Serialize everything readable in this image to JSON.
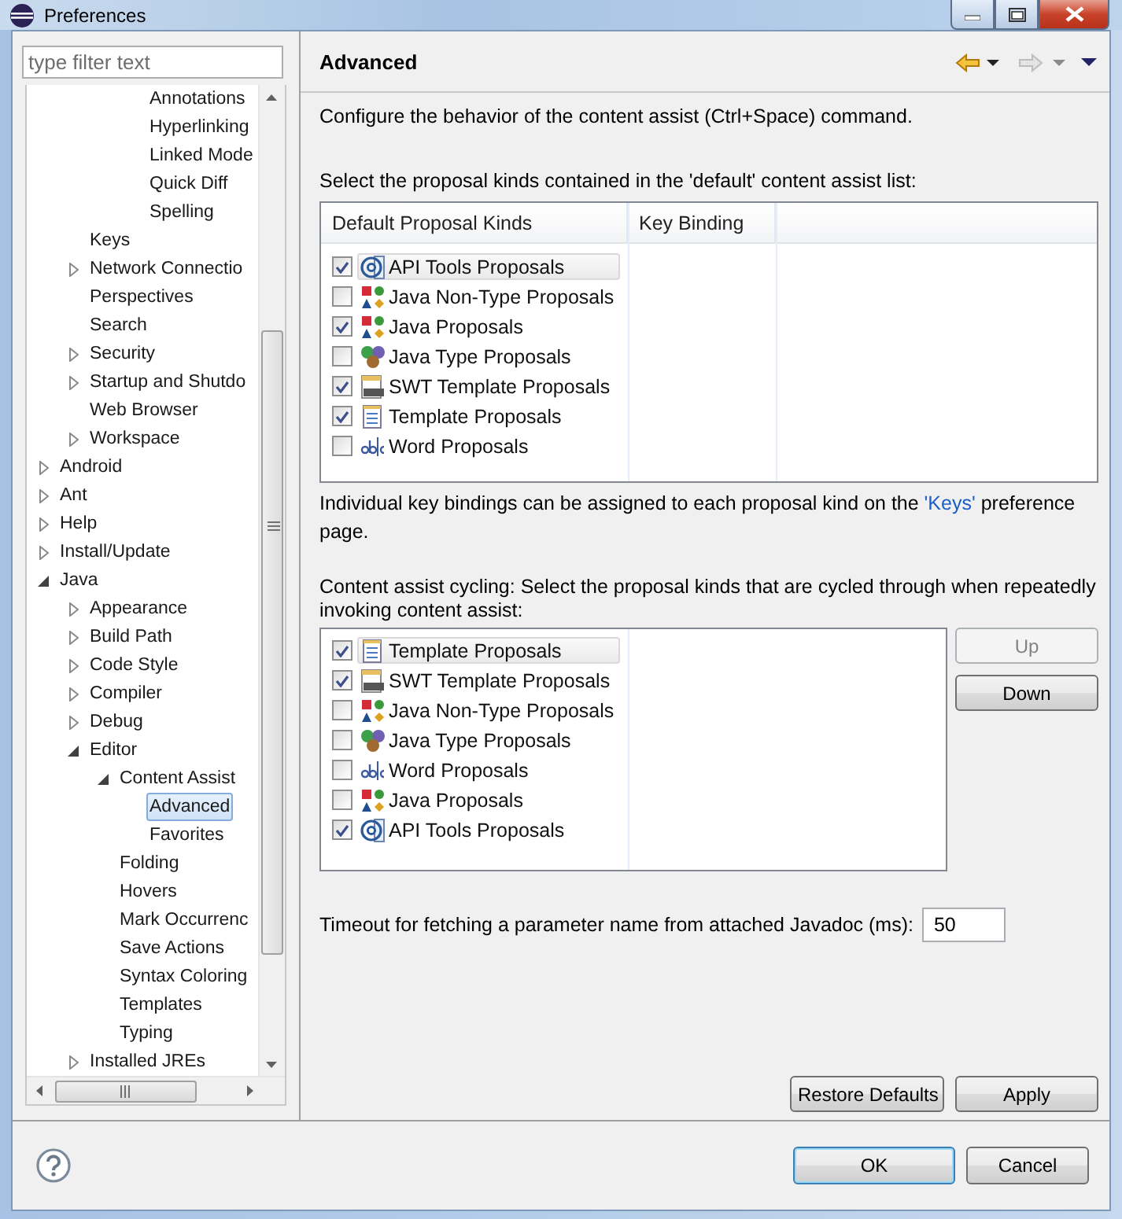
{
  "window": {
    "title": "Preferences"
  },
  "filter": {
    "placeholder": "type filter text"
  },
  "tree": [
    {
      "children": [
        {
          "children": [
            {
              "children": [
                {
                  "label": "Annotations",
                  "selected": false
                },
                {
                  "label": "Hyperlinking",
                  "selected": false
                },
                {
                  "label": "Linked Mode",
                  "selected": false
                },
                {
                  "label": "Quick Diff",
                  "selected": false
                },
                {
                  "label": "Spelling",
                  "selected": false
                }
              ]
            }
          ]
        },
        {
          "label": "Keys",
          "selected": false
        },
        {
          "label": "Network Connectio",
          "expanded": false,
          "selected": false
        },
        {
          "label": "Perspectives",
          "selected": false
        },
        {
          "label": "Search",
          "selected": false
        },
        {
          "label": "Security",
          "expanded": false,
          "selected": false
        },
        {
          "label": "Startup and Shutdo",
          "expanded": false,
          "selected": false
        },
        {
          "label": "Web Browser",
          "selected": false
        },
        {
          "label": "Workspace",
          "expanded": false,
          "selected": false
        }
      ]
    },
    {
      "label": "Android",
      "expanded": false,
      "selected": false
    },
    {
      "label": "Ant",
      "expanded": false,
      "selected": false
    },
    {
      "label": "Help",
      "expanded": false,
      "selected": false
    },
    {
      "label": "Install/Update",
      "expanded": false,
      "selected": false
    },
    {
      "label": "Java",
      "expanded": true,
      "selected": false,
      "children": [
        {
          "label": "Appearance",
          "expanded": false,
          "selected": false
        },
        {
          "label": "Build Path",
          "expanded": false,
          "selected": false
        },
        {
          "label": "Code Style",
          "expanded": false,
          "selected": false
        },
        {
          "label": "Compiler",
          "expanded": false,
          "selected": false
        },
        {
          "label": "Debug",
          "expanded": false,
          "selected": false
        },
        {
          "label": "Editor",
          "expanded": true,
          "selected": false,
          "children": [
            {
              "label": "Content Assist",
              "expanded": true,
              "selected": false,
              "children": [
                {
                  "label": "Advanced",
                  "selected": true
                },
                {
                  "label": "Favorites",
                  "selected": false
                }
              ]
            },
            {
              "label": "Folding",
              "selected": false
            },
            {
              "label": "Hovers",
              "selected": false
            },
            {
              "label": "Mark Occurrenc",
              "selected": false
            },
            {
              "label": "Save Actions",
              "selected": false
            },
            {
              "label": "Syntax Coloring",
              "selected": false
            },
            {
              "label": "Templates",
              "selected": false
            },
            {
              "label": "Typing",
              "selected": false
            }
          ]
        },
        {
          "label": "Installed JREs",
          "expanded": false,
          "selected": false
        }
      ]
    }
  ],
  "page": {
    "title": "Advanced",
    "nav": {
      "back_enabled": true,
      "forward_enabled": false
    },
    "description": "Configure the behavior of the content assist (Ctrl+Space) command.",
    "default_list": {
      "caption": "Select the proposal kinds contained in the 'default' content assist list:",
      "columns": [
        "Default Proposal Kinds",
        "Key Binding"
      ],
      "rows": [
        {
          "label": "API Tools Proposals",
          "kind": "api",
          "checked": true,
          "selected": true
        },
        {
          "label": "Java Non-Type Proposals",
          "kind": "java",
          "checked": false,
          "selected": false
        },
        {
          "label": "Java Proposals",
          "kind": "java",
          "checked": true,
          "selected": false
        },
        {
          "label": "Java Type Proposals",
          "kind": "type",
          "checked": false,
          "selected": false
        },
        {
          "label": "SWT Template Proposals",
          "kind": "swt",
          "checked": true,
          "selected": false
        },
        {
          "label": "Template Proposals",
          "kind": "template",
          "checked": true,
          "selected": false
        },
        {
          "label": "Word Proposals",
          "kind": "word",
          "checked": false,
          "selected": false
        }
      ]
    },
    "key_note": {
      "before": "Individual key bindings can be assigned to each proposal kind on the ",
      "link": "'Keys'",
      "after": " preference page."
    },
    "cycling_list": {
      "caption": "Content assist cycling: Select the proposal kinds that are cycled through when repeatedly invoking content assist:",
      "rows": [
        {
          "label": "Template Proposals",
          "kind": "template",
          "checked": true,
          "selected": true
        },
        {
          "label": "SWT Template Proposals",
          "kind": "swt",
          "checked": true,
          "selected": false
        },
        {
          "label": "Java Non-Type Proposals",
          "kind": "java",
          "checked": false,
          "selected": false
        },
        {
          "label": "Java Type Proposals",
          "kind": "type",
          "checked": false,
          "selected": false
        },
        {
          "label": "Word Proposals",
          "kind": "word",
          "checked": false,
          "selected": false
        },
        {
          "label": "Java Proposals",
          "kind": "java",
          "checked": false,
          "selected": false
        },
        {
          "label": "API Tools Proposals",
          "kind": "api",
          "checked": true,
          "selected": false
        }
      ],
      "buttons": [
        {
          "label": "Up",
          "disabled": true
        },
        {
          "label": "Down",
          "disabled": false
        }
      ]
    },
    "timeout": {
      "label": "Timeout for fetching a parameter name from attached Javadoc (ms):",
      "value": "50"
    },
    "buttons": [
      "Restore Defaults",
      "Apply"
    ]
  },
  "dialog_buttons": [
    {
      "label": "OK",
      "default": true
    },
    {
      "label": "Cancel",
      "default": false
    }
  ]
}
